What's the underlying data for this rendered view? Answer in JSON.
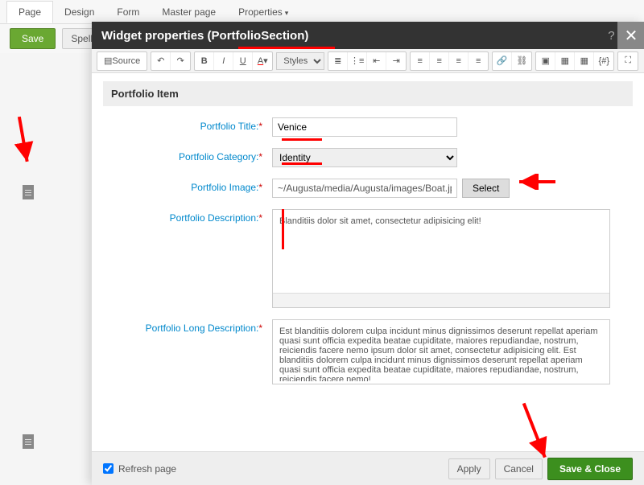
{
  "topbar": {
    "tabs": [
      "Page",
      "Design",
      "Form",
      "Master page",
      "Properties"
    ]
  },
  "secondbar": {
    "save": "Save",
    "spell": "Spell c"
  },
  "modal": {
    "title": "Widget properties (PortfolioSection)",
    "help": "?",
    "toolbar": {
      "source": "Source",
      "styles": "Styles"
    },
    "section_title": "Portfolio Item",
    "labels": {
      "title": "Portfolio Title:",
      "category": "Portfolio Category:",
      "image": "Portfolio Image:",
      "desc": "Portfolio Description:",
      "longdesc": "Portfolio Long Description:"
    },
    "values": {
      "title": "Venice",
      "category": "Identity",
      "image": "~/Augusta/media/Augusta/images/Boat.jpg",
      "desc": "Blanditiis dolor sit amet, consectetur adipisicing elit!",
      "longdesc": "Est blanditiis dolorem culpa incidunt minus dignissimos deserunt repellat aperiam quasi sunt officia expedita beatae cupiditate, maiores repudiandae, nostrum, reiciendis facere nemo ipsum dolor sit amet, consectetur adipisicing elit. Est blanditiis dolorem culpa incidunt minus dignissimos deserunt repellat aperiam quasi sunt officia expedita beatae cupiditate, maiores repudiandae, nostrum, reiciendis facere nemo!"
    },
    "select_btn": "Select",
    "footer": {
      "refresh": "Refresh page",
      "apply": "Apply",
      "cancel": "Cancel",
      "saveclose": "Save & Close"
    }
  }
}
